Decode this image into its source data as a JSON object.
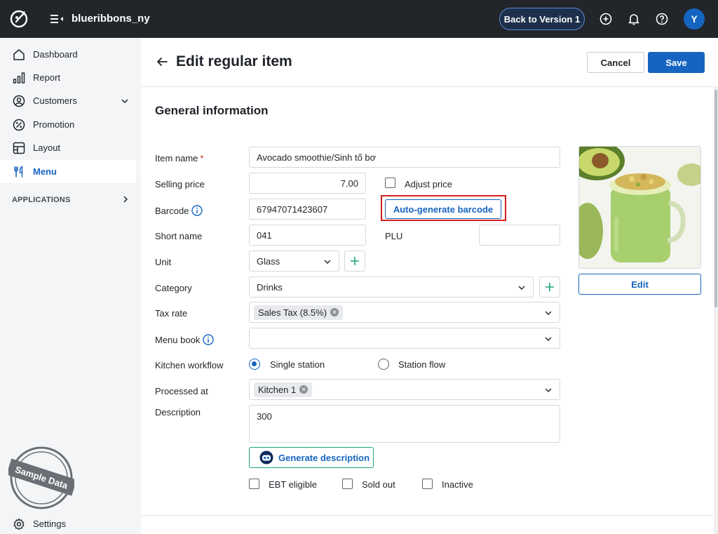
{
  "topbar": {
    "store_name": "blueribbons_ny",
    "back_version_label": "Back to Version 1",
    "avatar_initial": "Y"
  },
  "sidebar": {
    "items": [
      {
        "label": "Dashboard",
        "icon": "home-icon"
      },
      {
        "label": "Report",
        "icon": "bar-chart-icon"
      },
      {
        "label": "Customers",
        "icon": "user-circle-icon"
      },
      {
        "label": "Promotion",
        "icon": "percent-icon"
      },
      {
        "label": "Layout",
        "icon": "layout-icon"
      },
      {
        "label": "Menu",
        "icon": "fork-knife-icon",
        "active": true
      }
    ],
    "applications_label": "APPLICATIONS",
    "settings_label": "Settings",
    "stamp_text": "Sample Data"
  },
  "header": {
    "title": "Edit regular item",
    "cancel_label": "Cancel",
    "save_label": "Save"
  },
  "form": {
    "section_title": "General information",
    "item_name_label": "Item name",
    "required_mark": "*",
    "item_name_value": "Avocado smoothie/Sinh tố bơ",
    "selling_price_label": "Selling price",
    "selling_price_value": "7.00",
    "adjust_price_label": "Adjust price",
    "barcode_label": "Barcode",
    "barcode_value": "67947071423607",
    "autogen_label": "Auto-generate barcode",
    "short_name_label": "Short name",
    "short_name_value": "041",
    "plu_label": "PLU",
    "plu_value": "",
    "unit_label": "Unit",
    "unit_value": "Glass",
    "category_label": "Category",
    "category_value": "Drinks",
    "tax_rate_label": "Tax rate",
    "tax_rate_chip": "Sales Tax (8.5%)",
    "menu_book_label": "Menu book",
    "kitchen_workflow_label": "Kitchen workflow",
    "single_station_label": "Single station",
    "station_flow_label": "Station flow",
    "processed_at_label": "Processed at",
    "processed_at_chip": "Kitchen 1",
    "description_label": "Description",
    "description_value": "300",
    "generate_description_label": "Generate description",
    "ebt_label": "EBT eligible",
    "sold_out_label": "Sold out",
    "inactive_label": "Inactive",
    "edit_image_label": "Edit"
  },
  "colors": {
    "accent": "#1565c0",
    "topbar": "#22262a",
    "highlight": "#d42020"
  }
}
